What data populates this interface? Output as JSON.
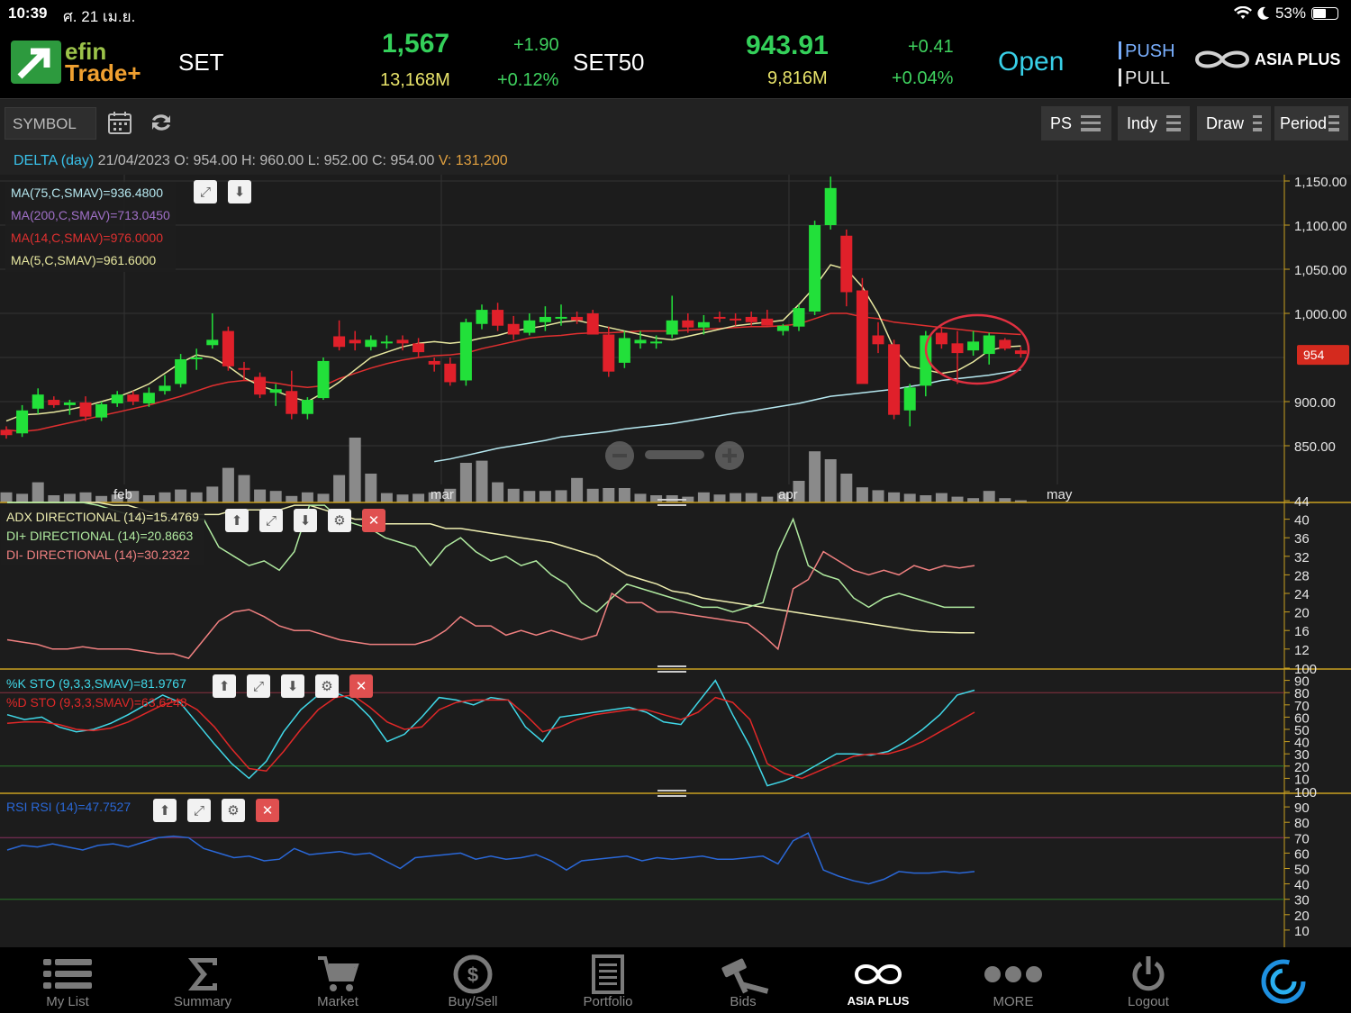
{
  "status_bar": {
    "time": "10:39",
    "date": "ศ. 21 เม.ย.",
    "battery": "53%"
  },
  "header": {
    "logo_top": "efin",
    "logo_bottom": "Trade+",
    "set": {
      "label": "SET",
      "value": "1,567",
      "change": "+1.90",
      "volume": "13,168M",
      "pct": "+0.12%"
    },
    "set50": {
      "label": "SET50",
      "value": "943.91",
      "change": "+0.41",
      "volume": "9,816M",
      "pct": "+0.04%"
    },
    "market_status": "Open",
    "push": "PUSH",
    "pull": "PULL",
    "brand": "ASIA PLUS"
  },
  "toolbar": {
    "symbol_placeholder": "SYMBOL",
    "ps": "PS",
    "indy": "Indy",
    "draw": "Draw",
    "period": "Period"
  },
  "info": {
    "symbol": "DELTA (day)",
    "date": "21/04/2023",
    "o_label": "O:",
    "o": "954.00",
    "h_label": "H:",
    "h": "960.00",
    "l_label": "L:",
    "l": "952.00",
    "c_label": "C:",
    "c": "954.00",
    "v_label": "V:",
    "v": "131,200"
  },
  "legends": {
    "ma75": "MA(75,C,SMAV)=936.4800",
    "ma200": "MA(200,C,SMAV)=713.0450",
    "ma14": "MA(14,C,SMAV)=976.0000",
    "ma5": "MA(5,C,SMAV)=961.6000",
    "adx": "ADX DIRECTIONAL (14)=15.4769",
    "di_plus": "DI+ DIRECTIONAL (14)=20.8663",
    "di_minus": "DI- DIRECTIONAL (14)=30.2322",
    "k_sto": "%K STO (9,3,3,SMAV)=81.9767",
    "d_sto": "%D STO (9,3,3,SMAV)=63.6248",
    "rsi": "RSI RSI (14)=47.7527"
  },
  "colors": {
    "up": "#22e03a",
    "down": "#e0202a",
    "ma75": "#b6e8f0",
    "ma200": "#a070c8",
    "ma14": "#e03030",
    "ma5": "#e8e8a0",
    "adx": "#eeeeb0",
    "di_plus": "#b0eaa0",
    "di_minus": "#f08080",
    "k": "#40d8e8",
    "d": "#e02828",
    "rsi": "#2a68d8",
    "separator": "#c9a020",
    "accent": "#38d0e8"
  },
  "chart_data": [
    {
      "type": "candlestick",
      "title": "DELTA (day)",
      "x_labels": [
        "feb",
        "mar",
        "apr",
        "may"
      ],
      "ylim": [
        830,
        1160
      ],
      "y_ticks": [
        "1,150.00",
        "1,100.00",
        "1,050.00",
        "1,000.00",
        "900.00",
        "850.00"
      ],
      "last_price_tag": "954",
      "ohlc": [
        [
          868,
          872,
          858,
          862
        ],
        [
          864,
          896,
          860,
          890
        ],
        [
          892,
          915,
          886,
          908
        ],
        [
          902,
          906,
          893,
          896
        ],
        [
          896,
          902,
          885,
          899
        ],
        [
          899,
          906,
          878,
          883
        ],
        [
          882,
          900,
          878,
          897
        ],
        [
          898,
          912,
          894,
          908
        ],
        [
          908,
          912,
          896,
          900
        ],
        [
          898,
          916,
          894,
          910
        ],
        [
          912,
          930,
          908,
          918
        ],
        [
          920,
          954,
          916,
          948
        ],
        [
          950,
          960,
          936,
          950
        ],
        [
          964,
          1000,
          960,
          970
        ],
        [
          980,
          985,
          935,
          940
        ],
        [
          938,
          945,
          924,
          936
        ],
        [
          928,
          933,
          904,
          908
        ],
        [
          910,
          920,
          895,
          914
        ],
        [
          912,
          935,
          880,
          886
        ],
        [
          886,
          905,
          880,
          902
        ],
        [
          904,
          950,
          902,
          946
        ],
        [
          974,
          992,
          958,
          962
        ],
        [
          970,
          980,
          958,
          966
        ],
        [
          962,
          975,
          958,
          970
        ],
        [
          966,
          975,
          960,
          968
        ],
        [
          970,
          975,
          958,
          966
        ],
        [
          966,
          972,
          950,
          956
        ],
        [
          946,
          950,
          934,
          942
        ],
        [
          943,
          950,
          918,
          922
        ],
        [
          924,
          994,
          918,
          990
        ],
        [
          988,
          1010,
          982,
          1004
        ],
        [
          1004,
          1012,
          980,
          986
        ],
        [
          988,
          997,
          970,
          976
        ],
        [
          978,
          1000,
          975,
          992
        ],
        [
          990,
          1008,
          980,
          996
        ],
        [
          996,
          1010,
          986,
          996
        ],
        [
          996,
          1002,
          988,
          992
        ],
        [
          1000,
          1004,
          980,
          976
        ],
        [
          976,
          985,
          928,
          934
        ],
        [
          944,
          980,
          938,
          972
        ],
        [
          966,
          980,
          960,
          970
        ],
        [
          968,
          975,
          960,
          968
        ],
        [
          976,
          1020,
          972,
          992
        ],
        [
          992,
          1000,
          978,
          984
        ],
        [
          984,
          998,
          976,
          990
        ],
        [
          996,
          1002,
          990,
          994
        ],
        [
          994,
          1000,
          986,
          992
        ],
        [
          996,
          1002,
          986,
          990
        ],
        [
          994,
          1004,
          986,
          986
        ],
        [
          980,
          988,
          975,
          986
        ],
        [
          985,
          1010,
          980,
          1006
        ],
        [
          1002,
          1105,
          998,
          1100
        ],
        [
          1100,
          1155,
          1095,
          1142
        ],
        [
          1088,
          1095,
          1008,
          1024
        ],
        [
          1026,
          1040,
          1014,
          920
        ],
        [
          975,
          990,
          955,
          965
        ],
        [
          965,
          970,
          880,
          885
        ],
        [
          890,
          920,
          872,
          916
        ],
        [
          918,
          980,
          906,
          975
        ],
        [
          978,
          985,
          960,
          965
        ],
        [
          966,
          980,
          920,
          955
        ],
        [
          958,
          980,
          952,
          968
        ],
        [
          954,
          978,
          942,
          975
        ],
        [
          970,
          972,
          958,
          960
        ],
        [
          958,
          962,
          950,
          954
        ]
      ],
      "volume": [
        14,
        12,
        28,
        10,
        12,
        14,
        9,
        11,
        16,
        10,
        14,
        18,
        14,
        22,
        48,
        38,
        18,
        16,
        9,
        14,
        12,
        38,
        90,
        40,
        13,
        11,
        12,
        14,
        19,
        55,
        58,
        28,
        19,
        16,
        16,
        17,
        34,
        19,
        20,
        20,
        12,
        10,
        10,
        8,
        14,
        11,
        13,
        13,
        8,
        13,
        30,
        71,
        60,
        40,
        21,
        17,
        14,
        12,
        10,
        13,
        8,
        6,
        16,
        6,
        3
      ],
      "ma5": [
        878,
        885,
        886,
        888,
        891,
        895,
        900,
        905,
        912,
        920,
        932,
        944,
        953,
        950,
        940,
        927,
        918,
        912,
        905,
        900,
        910,
        922,
        936,
        950,
        956,
        962,
        966,
        968,
        966,
        968,
        972,
        975,
        980,
        983,
        986,
        990,
        992,
        988,
        984,
        980,
        976,
        972,
        970,
        974,
        978,
        982,
        986,
        988,
        990,
        992,
        1010,
        1030,
        1055,
        1050,
        1030,
        1000,
        960,
        940,
        936,
        932,
        935,
        945,
        958,
        962,
        963
      ],
      "ma14": [
        868,
        866,
        868,
        872,
        876,
        880,
        884,
        888,
        892,
        896,
        901,
        906,
        912,
        918,
        922,
        924,
        923,
        921,
        918,
        916,
        918,
        926,
        932,
        938,
        943,
        947,
        950,
        952,
        953,
        955,
        960,
        964,
        968,
        972,
        974,
        975,
        977,
        978,
        978,
        979,
        980,
        980,
        980,
        981,
        982,
        983,
        984,
        985,
        985,
        986,
        988,
        994,
        1000,
        1000,
        996,
        994,
        990,
        988,
        986,
        984,
        982,
        980,
        978,
        977,
        976
      ],
      "ma75": [
        null,
        null,
        null,
        null,
        null,
        null,
        null,
        null,
        null,
        null,
        null,
        null,
        null,
        null,
        null,
        null,
        null,
        null,
        null,
        null,
        null,
        null,
        null,
        null,
        null,
        null,
        null,
        832,
        835,
        839,
        843,
        847,
        850,
        853,
        856,
        860,
        862,
        864,
        866,
        869,
        871,
        873,
        875,
        878,
        881,
        884,
        887,
        889,
        892,
        895,
        898,
        902,
        906,
        908,
        910,
        912,
        914,
        917,
        920,
        924,
        926,
        928,
        930,
        933,
        936
      ]
    },
    {
      "type": "line",
      "title": "ADX DIRECTIONAL (14)",
      "ylim": [
        10,
        44
      ],
      "y_ticks": [
        "44",
        "40",
        "36",
        "32",
        "28",
        "24",
        "20",
        "16",
        "12"
      ],
      "series": [
        {
          "name": "ADX DIRECTIONAL (14)",
          "values": [
            46,
            45,
            44,
            44,
            44,
            44,
            44,
            43,
            43,
            42,
            41,
            41,
            41,
            41,
            41,
            42,
            42,
            42,
            42,
            43,
            43,
            42,
            41,
            40,
            40,
            39,
            39,
            39,
            39,
            38,
            38,
            37.5,
            37,
            36.5,
            36,
            35.5,
            35,
            34,
            33,
            32,
            30,
            28,
            27,
            26,
            24.5,
            24,
            23,
            22.5,
            22,
            21.5,
            21,
            20.5,
            20,
            19.5,
            19,
            18.5,
            18,
            17.5,
            17,
            16.5,
            16,
            15.7,
            15.6,
            15.5,
            15.5
          ]
        },
        {
          "name": "DI+ DIRECTIONAL (14)",
          "values": [
            46,
            45,
            44,
            44,
            44,
            44,
            43,
            42,
            41,
            40,
            41,
            40,
            40,
            40,
            34,
            32,
            30,
            31,
            29,
            33,
            43,
            43,
            40,
            39,
            38,
            36,
            35,
            34,
            30,
            34,
            36,
            33,
            31,
            32,
            30,
            31,
            28,
            26,
            22,
            20,
            23,
            26,
            25,
            24,
            23,
            22,
            21,
            21,
            20,
            21,
            22,
            33,
            40,
            30,
            28,
            27,
            23,
            21,
            23,
            24,
            23,
            22,
            21,
            21,
            21
          ]
        },
        {
          "name": "DI- DIRECTIONAL (14)",
          "values": [
            14,
            13.5,
            13,
            12,
            12,
            12.5,
            12,
            12,
            12,
            11.5,
            11,
            11,
            10,
            14,
            18,
            20,
            20.5,
            19,
            17,
            16,
            16,
            15,
            14,
            13.5,
            13,
            13,
            13,
            13,
            14,
            16,
            19,
            17,
            17,
            15,
            16,
            15,
            16,
            15,
            14,
            15,
            24,
            22,
            22,
            20,
            20,
            19.5,
            19,
            18.5,
            18,
            17.5,
            15,
            12,
            25,
            27,
            33,
            31,
            29,
            28,
            29,
            28,
            30,
            29,
            30,
            29.5,
            30
          ]
        }
      ]
    },
    {
      "type": "line",
      "title": "%K STO (9,3,3,SMAV)",
      "ylim": [
        0,
        100
      ],
      "y_ticks": [
        "100",
        "90",
        "80",
        "70",
        "60",
        "50",
        "40",
        "30",
        "20",
        "10"
      ],
      "series": [
        {
          "name": "%K STO (9,3,3,SMAV)",
          "values": [
            62,
            58,
            60,
            52,
            48,
            50,
            55,
            62,
            70,
            78,
            72,
            55,
            38,
            22,
            10,
            24,
            48,
            66,
            78,
            80,
            74,
            60,
            40,
            46,
            60,
            76,
            74,
            70,
            76,
            74,
            52,
            40,
            60,
            62,
            64,
            66,
            68,
            64,
            56,
            54,
            72,
            90,
            62,
            36,
            4,
            8,
            14,
            22,
            30,
            30,
            29,
            32,
            40,
            50,
            62,
            78,
            82
          ]
        },
        {
          "name": "%D STO (9,3,3,SMAV)",
          "values": [
            55,
            56,
            56,
            54,
            50,
            49,
            51,
            56,
            63,
            70,
            74,
            66,
            52,
            34,
            18,
            16,
            32,
            50,
            66,
            76,
            78,
            68,
            56,
            50,
            52,
            66,
            72,
            74,
            74,
            74,
            62,
            48,
            52,
            58,
            62,
            64,
            66,
            66,
            62,
            58,
            64,
            76,
            72,
            58,
            22,
            14,
            10,
            16,
            22,
            28,
            30,
            30,
            34,
            40,
            48,
            56,
            64
          ]
        }
      ]
    },
    {
      "type": "line",
      "title": "RSI RSI (14)",
      "ylim": [
        0,
        100
      ],
      "y_ticks": [
        "100",
        "90",
        "80",
        "70",
        "60",
        "50",
        "40",
        "30",
        "20",
        "10"
      ],
      "series": [
        {
          "name": "RSI RSI (14)",
          "values": [
            62,
            65,
            64,
            66,
            64,
            62,
            65,
            66,
            64,
            67,
            70,
            71,
            70,
            63,
            60,
            57,
            58,
            55,
            56,
            63,
            59,
            60,
            61,
            59,
            60,
            55,
            50,
            57,
            58,
            59,
            60,
            56,
            58,
            56,
            57,
            59,
            55,
            49,
            55,
            56,
            57,
            58,
            55,
            57,
            56,
            57,
            58,
            56,
            56,
            57,
            58,
            53,
            68,
            73,
            49,
            45,
            42,
            40,
            43,
            48,
            47,
            47,
            48,
            47,
            48
          ]
        }
      ]
    }
  ],
  "nav": [
    {
      "label": "My List",
      "icon": "list-icon"
    },
    {
      "label": "Summary",
      "icon": "sigma-icon"
    },
    {
      "label": "Market",
      "icon": "cart-icon"
    },
    {
      "label": "Buy/Sell",
      "icon": "buy-sell-icon"
    },
    {
      "label": "Portfolio",
      "icon": "portfolio-icon"
    },
    {
      "label": "Bids",
      "icon": "gavel-icon"
    },
    {
      "label": "ASIA PLUS",
      "icon": "asia-plus-icon"
    },
    {
      "label": "MORE",
      "icon": "more-icon"
    },
    {
      "label": "Logout",
      "icon": "power-icon"
    }
  ]
}
